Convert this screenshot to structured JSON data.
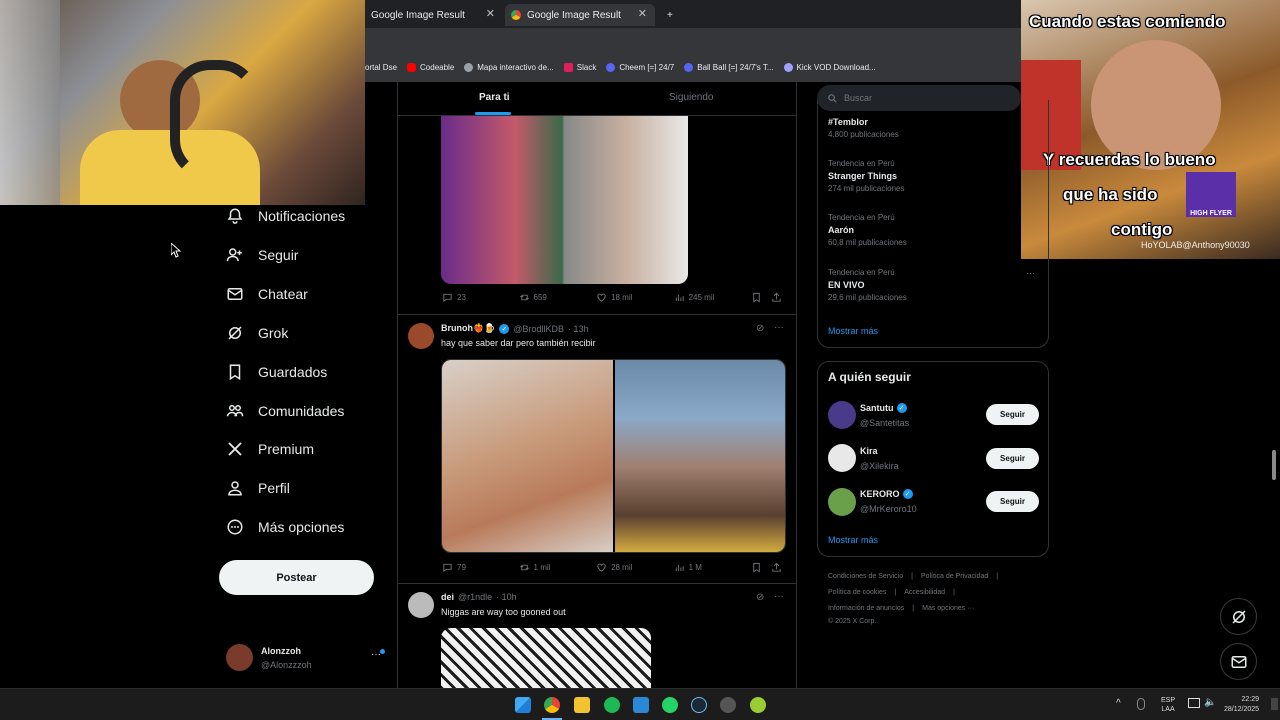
{
  "browser": {
    "tabs": [
      {
        "title": "Google Image Result"
      },
      {
        "title": "Google Image Result"
      }
    ],
    "new_tab": "+",
    "bookmarks": [
      {
        "label": "ortal Dse",
        "color": "#888888"
      },
      {
        "label": "Codeable",
        "color": "#ff0000"
      },
      {
        "label": "Mapa interactivo de...",
        "color": "#9aa0a6"
      },
      {
        "label": "Slack",
        "color": "#e01e5a"
      },
      {
        "label": "Cheem [=] 24/7",
        "color": "#5865f2"
      },
      {
        "label": "Ball Ball [=] 24/7's T...",
        "color": "#5865f2"
      },
      {
        "label": "Kick VOD Download...",
        "color": "#a0a0ff"
      }
    ]
  },
  "meme_overlay": {
    "top_text": "Cuando estas comiendo",
    "line1": "Y recuerdas lo bueno",
    "line2": "que ha sido",
    "line3": "contigo",
    "watermark": "HoYOLAB@Anthony90030",
    "badge": "HIGH FLYER"
  },
  "sidebar": {
    "items": [
      {
        "label": "Notificaciones",
        "icon": "bell-icon"
      },
      {
        "label": "Seguir",
        "icon": "follow-icon"
      },
      {
        "label": "Chatear",
        "icon": "mail-icon"
      },
      {
        "label": "Grok",
        "icon": "grok-icon"
      },
      {
        "label": "Guardados",
        "icon": "bookmark-icon"
      },
      {
        "label": "Comunidades",
        "icon": "communities-icon"
      },
      {
        "label": "Premium",
        "icon": "x-logo-icon"
      },
      {
        "label": "Perfil",
        "icon": "profile-icon"
      },
      {
        "label": "Más opciones",
        "icon": "more-circle-icon"
      }
    ],
    "post_button": "Postear",
    "account": {
      "name": "Alonzzoh",
      "handle": "@Alonzzzoh",
      "more": "···"
    }
  },
  "timeline": {
    "tabs": [
      "Para ti",
      "Siguiendo"
    ],
    "posts": [
      {
        "metrics": {
          "replies": "23",
          "reposts": "659",
          "likes": "18 mil",
          "views": "245 mil"
        }
      },
      {
        "name": "Brunoh❤️‍🔥🍺",
        "handle": "@BrodllKDB",
        "time": "· 13h",
        "text": "hay que saber dar pero también recibir",
        "metrics": {
          "replies": "79",
          "reposts": "1 mil",
          "likes": "28 mil",
          "views": "1 M"
        }
      },
      {
        "name": "dei",
        "handle": "@r1ndle",
        "time": "· 10h",
        "text": "Niggas are way too gooned out"
      }
    ]
  },
  "right": {
    "search_placeholder": "Buscar",
    "trends": [
      {
        "context": "",
        "name": "#Temblor",
        "count": "4.800 publicaciones"
      },
      {
        "context": "Tendencia en Perú",
        "name": "Stranger Things",
        "count": "274 mil publicaciones"
      },
      {
        "context": "Tendencia en Perú",
        "name": "Aarón",
        "count": "60,8 mil publicaciones"
      },
      {
        "context": "Tendencia en Perú",
        "name": "EN VIVO",
        "count": "29,6 mil publicaciones"
      }
    ],
    "show_more": "Mostrar más",
    "who_to_follow": {
      "title": "A quién seguir",
      "accounts": [
        {
          "name": "Santutu",
          "handle": "@Santetitas",
          "verified": true,
          "button": "Seguir"
        },
        {
          "name": "Kira",
          "handle": "@Xilekira",
          "verified": false,
          "button": "Seguir"
        },
        {
          "name": "KERORO",
          "handle": "@MrKeroro10",
          "verified": true,
          "button": "Seguir"
        }
      ],
      "show_more": "Mostrar más"
    },
    "footer": {
      "line1": [
        "Condiciones de Servicio",
        "|",
        "Política de Privacidad",
        "|"
      ],
      "line2": [
        "Política de cookies",
        "|",
        "Accesibilidad",
        "|"
      ],
      "line3": [
        "Información de anuncios",
        "|",
        "Más opciones ···"
      ],
      "copyright": "© 2025 X Corp."
    }
  },
  "taskbar": {
    "lang1": "ESP",
    "lang2": "LAA",
    "time": "22:29",
    "date": "28/12/2025"
  },
  "colors": {
    "accent": "#1d9bf0",
    "bg": "#000000",
    "border": "#2f3336"
  }
}
